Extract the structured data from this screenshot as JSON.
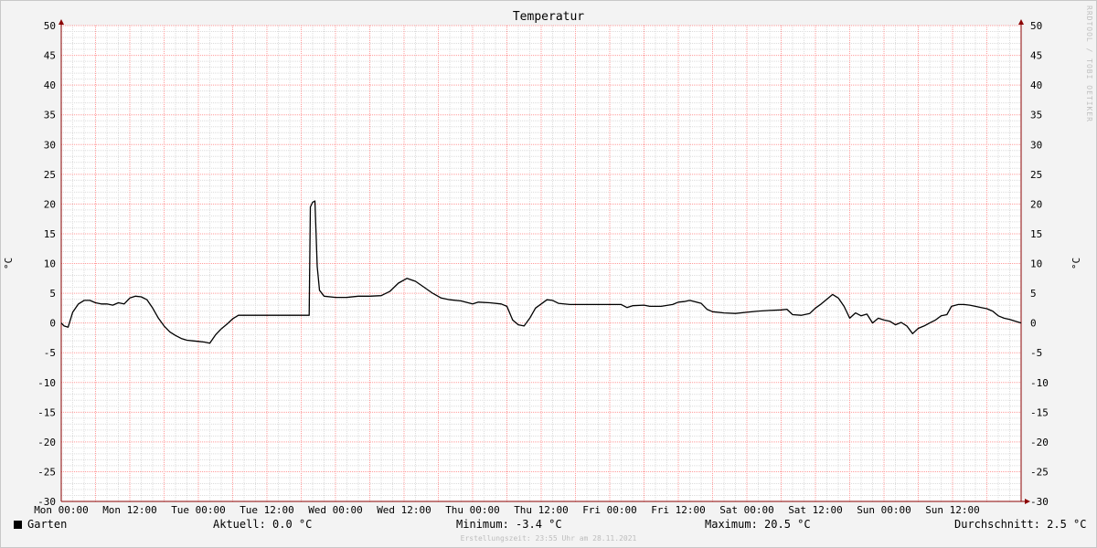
{
  "chart_data": {
    "type": "line",
    "title": "Temperatur",
    "ylabel": "°C",
    "ylim": [
      -30,
      50
    ],
    "y_ticks": [
      50,
      45,
      40,
      35,
      30,
      25,
      20,
      15,
      10,
      5,
      0,
      -5,
      -10,
      -15,
      -20,
      -25,
      -30
    ],
    "xlim_hours": [
      0,
      168
    ],
    "x_ticks": [
      {
        "label": "Mon 00:00",
        "hour": 0
      },
      {
        "label": "Mon 12:00",
        "hour": 12
      },
      {
        "label": "Tue 00:00",
        "hour": 24
      },
      {
        "label": "Tue 12:00",
        "hour": 36
      },
      {
        "label": "Wed 00:00",
        "hour": 48
      },
      {
        "label": "Wed 12:00",
        "hour": 60
      },
      {
        "label": "Thu 00:00",
        "hour": 72
      },
      {
        "label": "Thu 12:00",
        "hour": 84
      },
      {
        "label": "Fri 00:00",
        "hour": 96
      },
      {
        "label": "Fri 12:00",
        "hour": 108
      },
      {
        "label": "Sat 00:00",
        "hour": 120
      },
      {
        "label": "Sat 12:00",
        "hour": 132
      },
      {
        "label": "Sun 00:00",
        "hour": 144
      },
      {
        "label": "Sun 12:00",
        "hour": 156
      }
    ],
    "series": [
      {
        "name": "Garten",
        "color": "#000000",
        "points": [
          [
            0,
            0.0
          ],
          [
            0.5,
            -0.5
          ],
          [
            1.2,
            -0.7
          ],
          [
            2,
            1.8
          ],
          [
            3,
            3.2
          ],
          [
            4,
            3.8
          ],
          [
            5,
            3.8
          ],
          [
            6,
            3.4
          ],
          [
            7,
            3.2
          ],
          [
            8,
            3.2
          ],
          [
            9,
            3.0
          ],
          [
            10,
            3.4
          ],
          [
            11,
            3.2
          ],
          [
            12,
            4.2
          ],
          [
            13,
            4.5
          ],
          [
            14,
            4.4
          ],
          [
            15,
            3.9
          ],
          [
            16,
            2.5
          ],
          [
            17,
            0.8
          ],
          [
            18,
            -0.5
          ],
          [
            19,
            -1.5
          ],
          [
            20,
            -2.1
          ],
          [
            21,
            -2.6
          ],
          [
            22,
            -2.9
          ],
          [
            23,
            -3.0
          ],
          [
            24,
            -3.1
          ],
          [
            25,
            -3.2
          ],
          [
            26,
            -3.4
          ],
          [
            27,
            -2.0
          ],
          [
            28,
            -1.0
          ],
          [
            29,
            -0.2
          ],
          [
            30,
            0.7
          ],
          [
            31,
            1.3
          ],
          [
            34,
            1.3
          ],
          [
            38,
            1.3
          ],
          [
            42,
            1.3
          ],
          [
            43.4,
            1.3
          ],
          [
            43.6,
            19.5
          ],
          [
            44,
            20.3
          ],
          [
            44.4,
            20.5
          ],
          [
            44.8,
            9.5
          ],
          [
            45.2,
            5.5
          ],
          [
            46,
            4.5
          ],
          [
            48,
            4.3
          ],
          [
            50,
            4.3
          ],
          [
            52,
            4.5
          ],
          [
            54,
            4.5
          ],
          [
            56,
            4.6
          ],
          [
            57.5,
            5.3
          ],
          [
            59,
            6.7
          ],
          [
            60.5,
            7.5
          ],
          [
            62,
            7.0
          ],
          [
            63.5,
            6.0
          ],
          [
            65,
            5.0
          ],
          [
            66.5,
            4.2
          ],
          [
            68,
            3.9
          ],
          [
            70,
            3.7
          ],
          [
            72,
            3.2
          ],
          [
            73,
            3.5
          ],
          [
            75,
            3.4
          ],
          [
            77,
            3.2
          ],
          [
            78,
            2.8
          ],
          [
            79,
            0.5
          ],
          [
            80,
            -0.3
          ],
          [
            81,
            -0.5
          ],
          [
            82,
            0.8
          ],
          [
            83,
            2.5
          ],
          [
            84,
            3.2
          ],
          [
            85,
            3.9
          ],
          [
            86,
            3.8
          ],
          [
            87,
            3.3
          ],
          [
            89,
            3.1
          ],
          [
            92,
            3.1
          ],
          [
            96,
            3.1
          ],
          [
            98,
            3.1
          ],
          [
            99,
            2.6
          ],
          [
            100,
            2.9
          ],
          [
            102,
            3.0
          ],
          [
            103,
            2.8
          ],
          [
            105,
            2.8
          ],
          [
            107,
            3.1
          ],
          [
            108,
            3.5
          ],
          [
            109,
            3.6
          ],
          [
            110,
            3.8
          ],
          [
            112,
            3.3
          ],
          [
            113,
            2.3
          ],
          [
            114,
            1.9
          ],
          [
            116,
            1.7
          ],
          [
            118,
            1.6
          ],
          [
            120,
            1.8
          ],
          [
            122,
            2.0
          ],
          [
            124,
            2.1
          ],
          [
            126,
            2.2
          ],
          [
            127,
            2.3
          ],
          [
            128,
            1.4
          ],
          [
            129.5,
            1.3
          ],
          [
            131,
            1.6
          ],
          [
            132,
            2.5
          ],
          [
            133,
            3.2
          ],
          [
            134,
            4.0
          ],
          [
            135,
            4.8
          ],
          [
            136,
            4.2
          ],
          [
            137,
            2.8
          ],
          [
            138,
            0.8
          ],
          [
            139,
            1.7
          ],
          [
            140,
            1.2
          ],
          [
            141,
            1.5
          ],
          [
            142,
            0.0
          ],
          [
            143,
            0.8
          ],
          [
            144,
            0.5
          ],
          [
            145,
            0.3
          ],
          [
            146,
            -0.3
          ],
          [
            147,
            0.1
          ],
          [
            148,
            -0.5
          ],
          [
            149,
            -1.8
          ],
          [
            150,
            -0.9
          ],
          [
            151,
            -0.5
          ],
          [
            152,
            0.0
          ],
          [
            153,
            0.5
          ],
          [
            154,
            1.2
          ],
          [
            155,
            1.4
          ],
          [
            155.8,
            2.8
          ],
          [
            157,
            3.1
          ],
          [
            158,
            3.1
          ],
          [
            159,
            3.0
          ],
          [
            160,
            2.8
          ],
          [
            161,
            2.6
          ],
          [
            162,
            2.4
          ],
          [
            163,
            2.0
          ],
          [
            164,
            1.2
          ],
          [
            165,
            0.8
          ],
          [
            166,
            0.6
          ],
          [
            167,
            0.3
          ],
          [
            168,
            0.0
          ]
        ]
      }
    ],
    "legend": {
      "name": "Garten",
      "aktuell": "Aktuell: 0.0 °C",
      "minimum": "Minimum: -3.4 °C",
      "maximum": "Maximum: 20.5 °C",
      "durchschnitt": "Durchschnitt: 2.5 °C"
    },
    "grid": true,
    "colors": {
      "minor_grid": "#dcdcdc",
      "major_grid": "#ff9a9a",
      "axis": "#8b0000",
      "line": "#000000",
      "background": "#ffffff"
    }
  },
  "watermark": "RRDTOOL / TOBI OETIKER",
  "footer": "Erstellungszeit: 23:55 Uhr am 28.11.2021"
}
